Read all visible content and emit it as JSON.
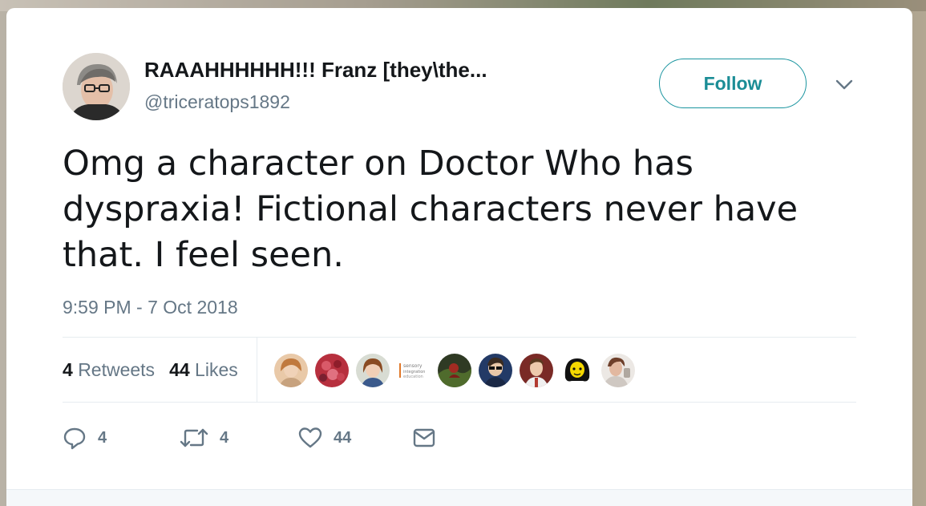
{
  "tweet": {
    "author": {
      "display_name": "RAAAHHHHHH!!! Franz [they\\the...",
      "handle": "@triceratops1892",
      "avatar_icon": "user-avatar"
    },
    "follow_label": "Follow",
    "menu_icon": "chevron-down-icon",
    "text": "Omg a character on Doctor Who has dyspraxia! Fictional characters never have that. I feel seen.",
    "timestamp": "9:59 PM - 7 Oct 2018",
    "stats": {
      "retweets_count": "4",
      "retweets_label": "Retweets",
      "likes_count": "44",
      "likes_label": "Likes"
    },
    "likers": [
      {
        "icon": "user-avatar"
      },
      {
        "icon": "user-avatar"
      },
      {
        "icon": "user-avatar"
      },
      {
        "icon": "logo-avatar",
        "logo_lines": [
          "sensory",
          "integration",
          "education"
        ]
      },
      {
        "icon": "user-avatar"
      },
      {
        "icon": "user-avatar"
      },
      {
        "icon": "user-avatar"
      },
      {
        "icon": "cartoon-avatar"
      },
      {
        "icon": "user-avatar"
      }
    ],
    "actions": {
      "reply_count": "4",
      "retweet_count": "4",
      "like_count": "44"
    },
    "colors": {
      "accent": "#1b95a0",
      "text": "#14171a",
      "muted": "#657786",
      "divider": "#e6ecf0"
    }
  }
}
